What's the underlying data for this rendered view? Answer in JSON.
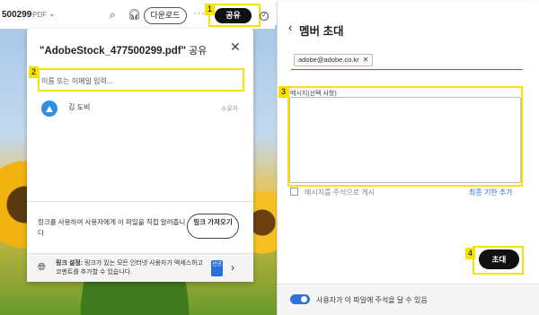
{
  "topbar": {
    "filename": "500299",
    "filetype": "PDF",
    "download_label": "다운로드",
    "more": "···",
    "share_label": "공유"
  },
  "markers": [
    "1",
    "2",
    "3",
    "4"
  ],
  "share_panel": {
    "file_title": "\"AdobeStock_477500299.pdf\"",
    "title_suffix": " 공유",
    "name_input_placeholder": "이름 또는 이메일 입력...",
    "person_name": "김 도비",
    "person_role": "소유자",
    "link_text": "링크를 사용하여 사용자에게 이 파일을 직접 알려줍니다",
    "get_link_label": "링크 가져오기",
    "footer_label": "링크 설정:",
    "footer_text": " 링크가 있는 모든 인터넷 사용자가 액세스하고 코멘트를 추가할 수 있습니다.",
    "footer_badge": "선공"
  },
  "invite_panel": {
    "title": "멤버 초대",
    "email_chip": "adobe@adobe.co.kr",
    "message_label": "메시지(선택 사항)",
    "comment_label": "메시지를 주석으로 게시",
    "deadline_label": "최종 기한 추가",
    "invite_label": "초대",
    "toggle_label": "사용자가 이 파일에 주석을 달 수 있음"
  }
}
